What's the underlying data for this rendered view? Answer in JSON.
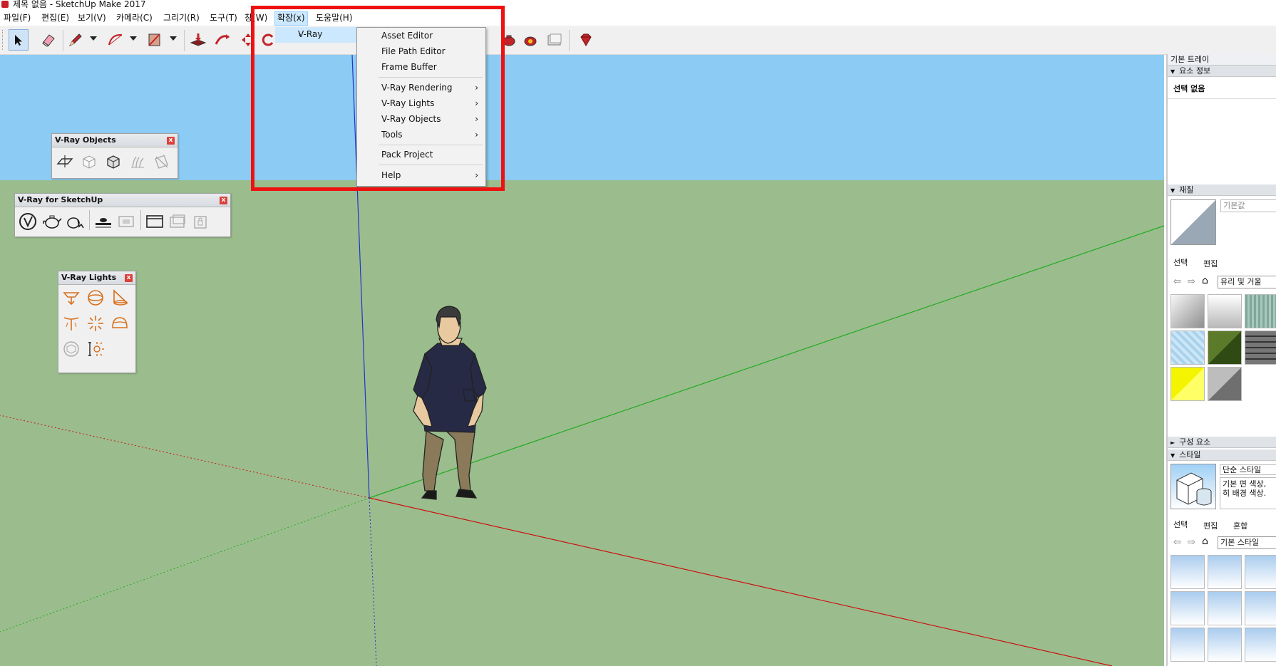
{
  "window": {
    "title": "제목 없음 - SketchUp Make 2017"
  },
  "menubar": {
    "items": [
      "파일(F)",
      "편집(E)",
      "보기(V)",
      "카메라(C)",
      "그리기(R)",
      "도구(T)",
      "창(W)",
      "확장(x)",
      "도움말(H)"
    ],
    "active": "확장(x)"
  },
  "extension_menu": {
    "vray_label": "V-Ray",
    "submenu": {
      "asset_editor": "Asset Editor",
      "file_path_editor": "File Path Editor",
      "frame_buffer": "Frame Buffer",
      "vray_rendering": "V-Ray Rendering",
      "vray_lights": "V-Ray Lights",
      "vray_objects": "V-Ray Objects",
      "tools": "Tools",
      "pack_project": "Pack Project",
      "help": "Help"
    }
  },
  "panels": {
    "vray_objects": {
      "title": "V-Ray Objects",
      "close": "x"
    },
    "vray_for_sketchup": {
      "title": "V-Ray for SketchUp",
      "close": "x"
    },
    "vray_lights": {
      "title": "V-Ray Lights",
      "close": "x"
    }
  },
  "tray": {
    "title": "기본 트레이",
    "entity_info": {
      "header": "요소 정보",
      "value": "선택 없음"
    },
    "materials": {
      "header": "재질",
      "name_value": "기본값",
      "tab_select": "선택",
      "tab_edit": "편집",
      "library": "유리 및 거울"
    },
    "components": {
      "header": "구성 요소"
    },
    "styles": {
      "header": "스타일",
      "name": "단순 스타일",
      "description": "기본 면 색상, 히 배경 색상.",
      "tab_select": "선택",
      "tab_edit": "편집",
      "tab_mix": "혼합",
      "library": "기본 스타일"
    }
  },
  "colors": {
    "sky": "#8ccbf3",
    "ground": "#9bbd8d",
    "highlight": "#ee1111",
    "axis_red": "#cc1111",
    "axis_green": "#22aa22",
    "axis_blue": "#2233cc",
    "vray_orange": "#d7701d"
  }
}
